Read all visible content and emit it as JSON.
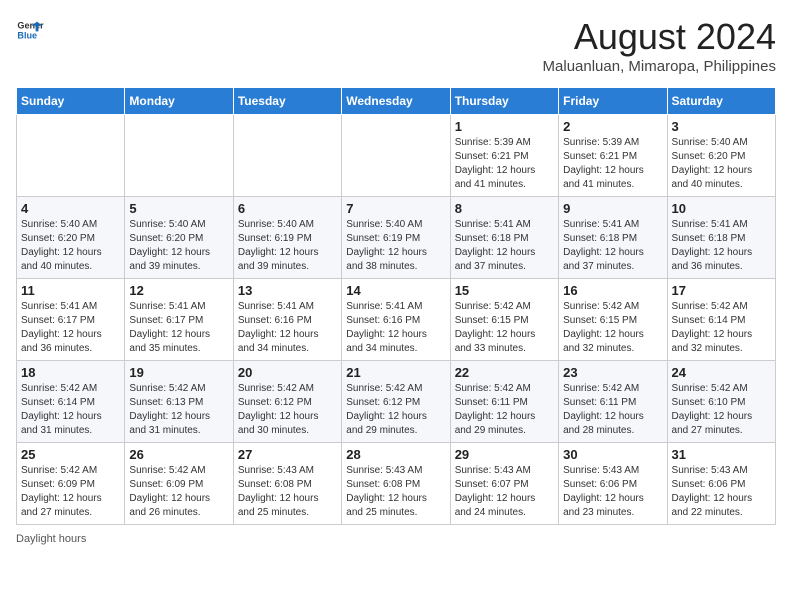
{
  "header": {
    "logo_general": "General",
    "logo_blue": "Blue",
    "month_year": "August 2024",
    "location": "Maluanluan, Mimaropa, Philippines"
  },
  "days_of_week": [
    "Sunday",
    "Monday",
    "Tuesday",
    "Wednesday",
    "Thursday",
    "Friday",
    "Saturday"
  ],
  "weeks": [
    [
      {
        "day": "",
        "info": ""
      },
      {
        "day": "",
        "info": ""
      },
      {
        "day": "",
        "info": ""
      },
      {
        "day": "",
        "info": ""
      },
      {
        "day": "1",
        "info": "Sunrise: 5:39 AM\nSunset: 6:21 PM\nDaylight: 12 hours\nand 41 minutes."
      },
      {
        "day": "2",
        "info": "Sunrise: 5:39 AM\nSunset: 6:21 PM\nDaylight: 12 hours\nand 41 minutes."
      },
      {
        "day": "3",
        "info": "Sunrise: 5:40 AM\nSunset: 6:20 PM\nDaylight: 12 hours\nand 40 minutes."
      }
    ],
    [
      {
        "day": "4",
        "info": "Sunrise: 5:40 AM\nSunset: 6:20 PM\nDaylight: 12 hours\nand 40 minutes."
      },
      {
        "day": "5",
        "info": "Sunrise: 5:40 AM\nSunset: 6:20 PM\nDaylight: 12 hours\nand 39 minutes."
      },
      {
        "day": "6",
        "info": "Sunrise: 5:40 AM\nSunset: 6:19 PM\nDaylight: 12 hours\nand 39 minutes."
      },
      {
        "day": "7",
        "info": "Sunrise: 5:40 AM\nSunset: 6:19 PM\nDaylight: 12 hours\nand 38 minutes."
      },
      {
        "day": "8",
        "info": "Sunrise: 5:41 AM\nSunset: 6:18 PM\nDaylight: 12 hours\nand 37 minutes."
      },
      {
        "day": "9",
        "info": "Sunrise: 5:41 AM\nSunset: 6:18 PM\nDaylight: 12 hours\nand 37 minutes."
      },
      {
        "day": "10",
        "info": "Sunrise: 5:41 AM\nSunset: 6:18 PM\nDaylight: 12 hours\nand 36 minutes."
      }
    ],
    [
      {
        "day": "11",
        "info": "Sunrise: 5:41 AM\nSunset: 6:17 PM\nDaylight: 12 hours\nand 36 minutes."
      },
      {
        "day": "12",
        "info": "Sunrise: 5:41 AM\nSunset: 6:17 PM\nDaylight: 12 hours\nand 35 minutes."
      },
      {
        "day": "13",
        "info": "Sunrise: 5:41 AM\nSunset: 6:16 PM\nDaylight: 12 hours\nand 34 minutes."
      },
      {
        "day": "14",
        "info": "Sunrise: 5:41 AM\nSunset: 6:16 PM\nDaylight: 12 hours\nand 34 minutes."
      },
      {
        "day": "15",
        "info": "Sunrise: 5:42 AM\nSunset: 6:15 PM\nDaylight: 12 hours\nand 33 minutes."
      },
      {
        "day": "16",
        "info": "Sunrise: 5:42 AM\nSunset: 6:15 PM\nDaylight: 12 hours\nand 32 minutes."
      },
      {
        "day": "17",
        "info": "Sunrise: 5:42 AM\nSunset: 6:14 PM\nDaylight: 12 hours\nand 32 minutes."
      }
    ],
    [
      {
        "day": "18",
        "info": "Sunrise: 5:42 AM\nSunset: 6:14 PM\nDaylight: 12 hours\nand 31 minutes."
      },
      {
        "day": "19",
        "info": "Sunrise: 5:42 AM\nSunset: 6:13 PM\nDaylight: 12 hours\nand 31 minutes."
      },
      {
        "day": "20",
        "info": "Sunrise: 5:42 AM\nSunset: 6:12 PM\nDaylight: 12 hours\nand 30 minutes."
      },
      {
        "day": "21",
        "info": "Sunrise: 5:42 AM\nSunset: 6:12 PM\nDaylight: 12 hours\nand 29 minutes."
      },
      {
        "day": "22",
        "info": "Sunrise: 5:42 AM\nSunset: 6:11 PM\nDaylight: 12 hours\nand 29 minutes."
      },
      {
        "day": "23",
        "info": "Sunrise: 5:42 AM\nSunset: 6:11 PM\nDaylight: 12 hours\nand 28 minutes."
      },
      {
        "day": "24",
        "info": "Sunrise: 5:42 AM\nSunset: 6:10 PM\nDaylight: 12 hours\nand 27 minutes."
      }
    ],
    [
      {
        "day": "25",
        "info": "Sunrise: 5:42 AM\nSunset: 6:09 PM\nDaylight: 12 hours\nand 27 minutes."
      },
      {
        "day": "26",
        "info": "Sunrise: 5:42 AM\nSunset: 6:09 PM\nDaylight: 12 hours\nand 26 minutes."
      },
      {
        "day": "27",
        "info": "Sunrise: 5:43 AM\nSunset: 6:08 PM\nDaylight: 12 hours\nand 25 minutes."
      },
      {
        "day": "28",
        "info": "Sunrise: 5:43 AM\nSunset: 6:08 PM\nDaylight: 12 hours\nand 25 minutes."
      },
      {
        "day": "29",
        "info": "Sunrise: 5:43 AM\nSunset: 6:07 PM\nDaylight: 12 hours\nand 24 minutes."
      },
      {
        "day": "30",
        "info": "Sunrise: 5:43 AM\nSunset: 6:06 PM\nDaylight: 12 hours\nand 23 minutes."
      },
      {
        "day": "31",
        "info": "Sunrise: 5:43 AM\nSunset: 6:06 PM\nDaylight: 12 hours\nand 22 minutes."
      }
    ]
  ],
  "footer": {
    "note": "Daylight hours"
  }
}
